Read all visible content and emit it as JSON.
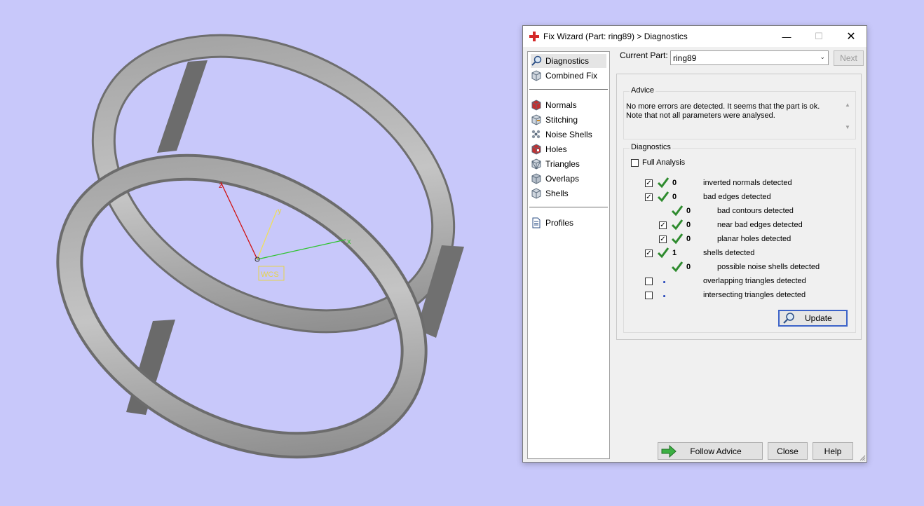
{
  "viewport": {
    "axis_labels": [
      "z",
      "y",
      "x"
    ],
    "wcs_label": "WCS"
  },
  "dialog": {
    "title": "Fix Wizard (Part: ring89) > Diagnostics",
    "nav": {
      "top": [
        {
          "label": "Diagnostics",
          "icon": "magnifier-icon"
        },
        {
          "label": "Combined Fix",
          "icon": "cube-icon"
        }
      ],
      "tools": [
        {
          "label": "Normals",
          "icon": "normals-cube-icon"
        },
        {
          "label": "Stitching",
          "icon": "stitching-cube-icon"
        },
        {
          "label": "Noise Shells",
          "icon": "noise-shells-icon"
        },
        {
          "label": "Holes",
          "icon": "holes-cube-icon"
        },
        {
          "label": "Triangles",
          "icon": "triangles-cube-icon"
        },
        {
          "label": "Overlaps",
          "icon": "overlaps-cube-icon"
        },
        {
          "label": "Shells",
          "icon": "shells-cube-icon"
        }
      ],
      "bottom": [
        {
          "label": "Profiles",
          "icon": "document-icon"
        }
      ]
    },
    "current_part_label": "Current Part:",
    "current_part_value": "ring89",
    "next_label": "Next",
    "advice": {
      "title": "Advice",
      "line1": "No more errors are detected. It seems that the part is ok.",
      "line2": "Note that not all parameters were analysed."
    },
    "diagnostics": {
      "title": "Diagnostics",
      "full_analysis_label": "Full Analysis",
      "full_analysis_checked": false,
      "rows": [
        {
          "label": "inverted normals detected",
          "count": "0",
          "checked": true,
          "status": "ok"
        },
        {
          "label": "bad edges detected",
          "count": "0",
          "checked": true,
          "status": "ok"
        },
        {
          "label": "bad contours detected",
          "count": "0",
          "checked": null,
          "status": "ok"
        },
        {
          "label": "near bad edges detected",
          "count": "0",
          "checked": true,
          "status": "ok"
        },
        {
          "label": "planar holes detected",
          "count": "0",
          "checked": true,
          "status": "ok"
        },
        {
          "label": "shells detected",
          "count": "1",
          "checked": true,
          "status": "ok"
        },
        {
          "label": "possible noise shells detected",
          "count": "0",
          "checked": null,
          "status": "ok"
        },
        {
          "label": "overlapping triangles detected",
          "count": "",
          "checked": false,
          "status": "none"
        },
        {
          "label": "intersecting triangles detected",
          "count": "",
          "checked": false,
          "status": "none"
        }
      ]
    },
    "update_label": "Update",
    "buttons": {
      "follow_advice": "Follow Advice",
      "close": "Close",
      "help": "Help"
    },
    "colors": {
      "accent": "#3c63c8",
      "check_green": "#2e8b2e",
      "title_icon": "#d42a2a"
    }
  }
}
